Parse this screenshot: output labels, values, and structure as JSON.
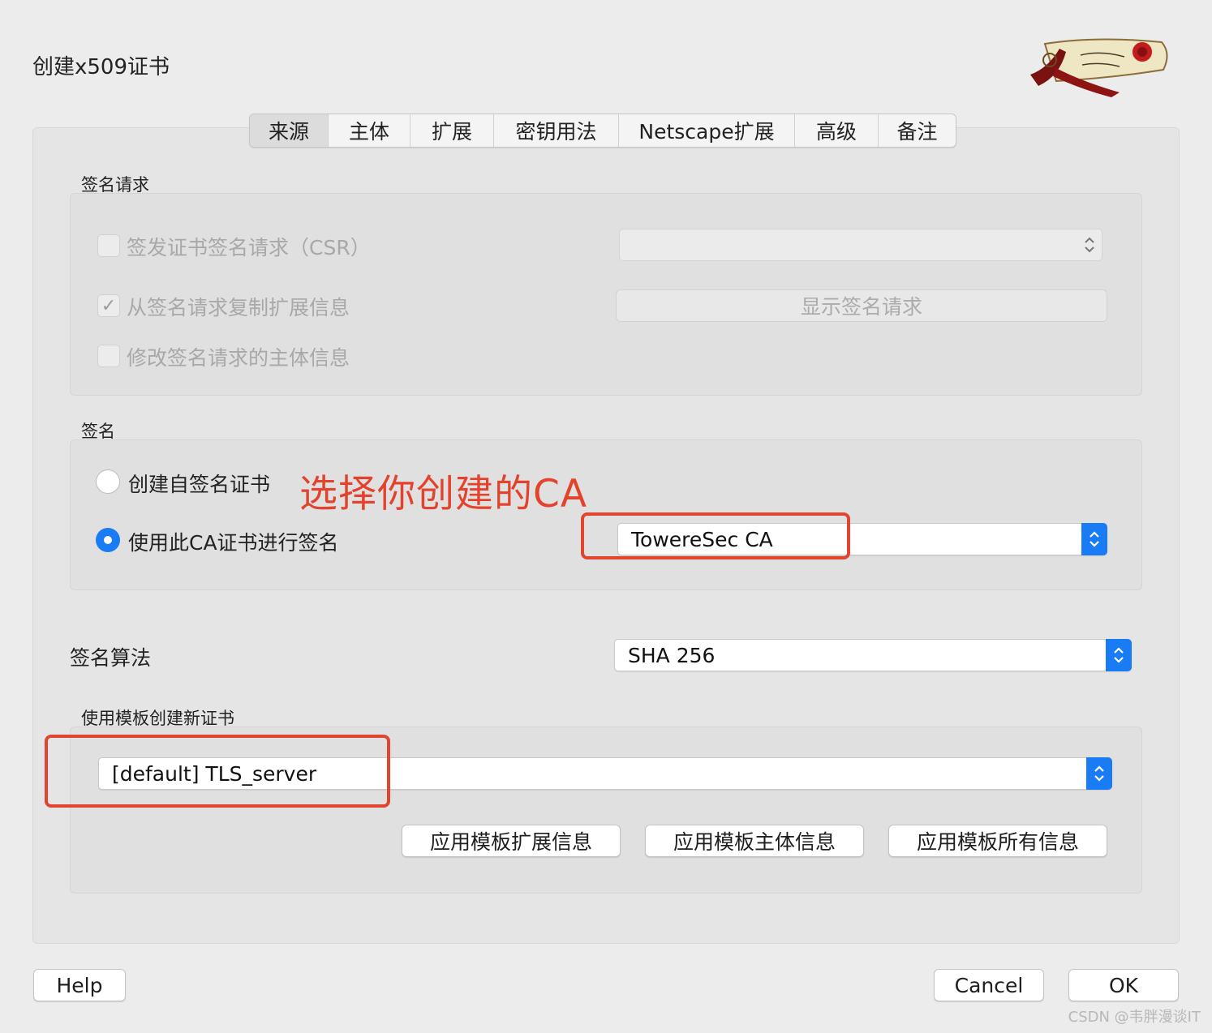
{
  "window": {
    "title": "创建x509证书"
  },
  "tabs": [
    {
      "label": "来源",
      "active": true
    },
    {
      "label": "主体"
    },
    {
      "label": "扩展"
    },
    {
      "label": "密钥用法"
    },
    {
      "label": "Netscape扩展"
    },
    {
      "label": "高级"
    },
    {
      "label": "备注"
    }
  ],
  "signing_request": {
    "group_label": "签名请求",
    "issue_csr": {
      "label": "签发证书签名请求（CSR）",
      "checked": false
    },
    "copy_extensions": {
      "label": "从签名请求复制扩展信息",
      "checked": true
    },
    "modify_subject": {
      "label": "修改签名请求的主体信息",
      "checked": false
    },
    "csr_select_value": "",
    "show_request_button": "显示签名请求"
  },
  "signing": {
    "group_label": "签名",
    "self_signed": {
      "label": "创建自签名证书",
      "selected": false
    },
    "use_ca": {
      "label": "使用此CA证书进行签名",
      "selected": true
    },
    "ca_select_value": "TowereSec CA"
  },
  "annotations": {
    "ca_note": "选择你创建的CA",
    "highlight_color": "#e0452f"
  },
  "algorithm": {
    "label": "签名算法",
    "value": "SHA 256"
  },
  "template": {
    "group_label": "使用模板创建新证书",
    "select_value": "[default] TLS_server",
    "apply_extensions": "应用模板扩展信息",
    "apply_subject": "应用模板主体信息",
    "apply_all": "应用模板所有信息"
  },
  "footer": {
    "help": "Help",
    "cancel": "Cancel",
    "ok": "OK"
  },
  "watermark": "CSDN @韦胖漫谈IT",
  "colors": {
    "accent": "#1a7cf5",
    "background": "#ececec",
    "annotation": "#e3432c"
  },
  "icons": {
    "checkmark": "checkmark-icon",
    "stepper": "updown-chevron-icon",
    "logo": "scroll-rose-logo"
  }
}
